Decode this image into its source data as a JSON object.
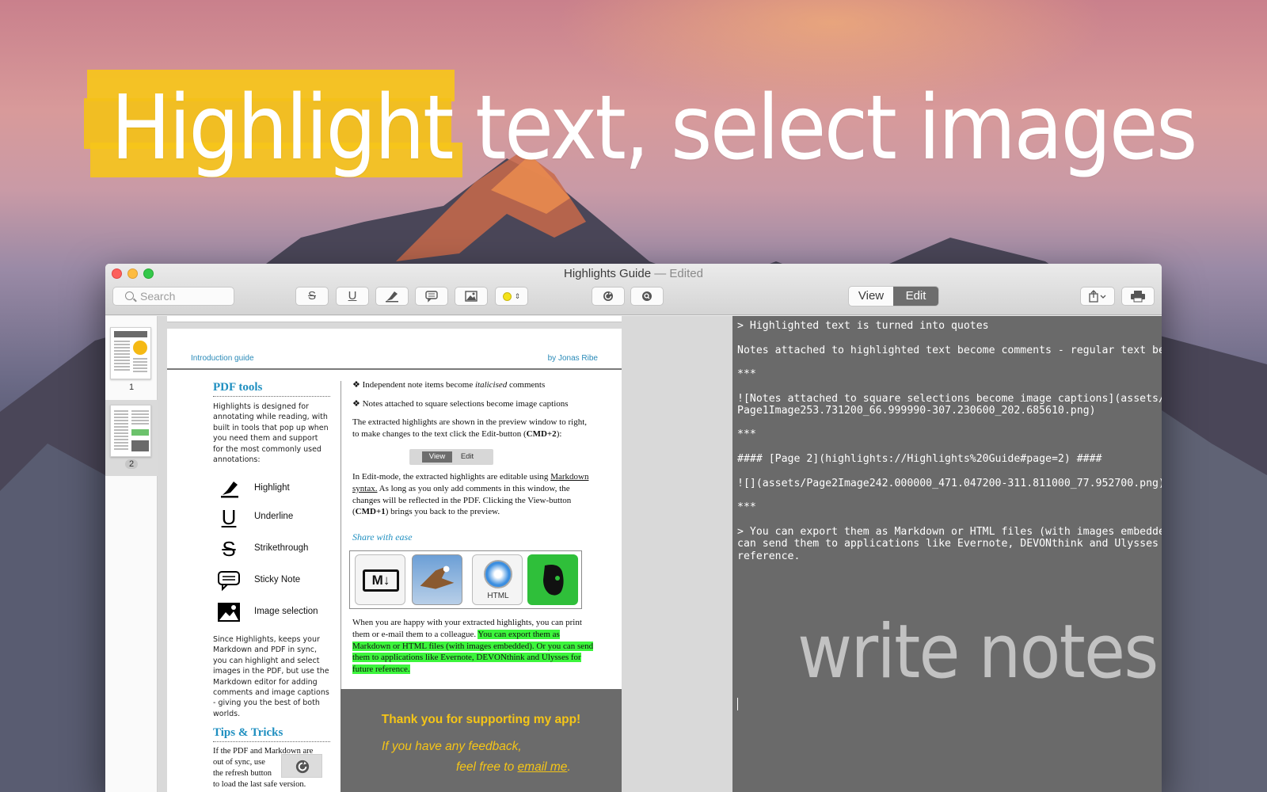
{
  "headline": {
    "highlight_word": "Highlight",
    "rest": " text, select images"
  },
  "window": {
    "title": "Highlights Guide",
    "title_separator": "—",
    "title_status": "Edited"
  },
  "toolbar": {
    "search_placeholder": "Search",
    "strike_glyph": "S",
    "underline_glyph": "U",
    "view_label": "View",
    "edit_label": "Edit"
  },
  "sidebar": {
    "pages": [
      {
        "label": "1"
      },
      {
        "label": "2"
      }
    ]
  },
  "pdf": {
    "header_left": "Introduction guide",
    "header_right": "by Jonas Ribe",
    "pdf_tools_title": "PDF tools",
    "intro_para": "Highlights is designed for annotating while reading, with built in tools that pop up when you need them and support for the  most commonly used annotations:",
    "tools": [
      {
        "label": "Highlight",
        "icon": "highlighter-icon"
      },
      {
        "label": "Underline",
        "icon": "underline-icon"
      },
      {
        "label": "Strikethrough",
        "icon": "strikethrough-icon"
      },
      {
        "label": "Sticky Note",
        "icon": "sticky-note-icon"
      },
      {
        "label": "Image selection",
        "icon": "image-selection-icon"
      }
    ],
    "sync_para": "Since Highlights, keeps your Markdown and PDF in sync, you can highlight and select images in the PDF, but use the Markdown editor for adding comments and image captions - giving you the best of both worlds.",
    "tips_title": "Tips & Tricks",
    "tips_l1": "If the PDF and Markdown are",
    "tips_l2": "out of sync, use",
    "tips_l3": "the refresh button",
    "tips_l4": "to load the last safe version.",
    "bullet1_pre": "❖ Independent note items become ",
    "bullet1_em": "italicised",
    "bullet1_post": " comments",
    "bullet2": "❖ Notes attached to square selections become image captions",
    "preview_pre": "The extracted highlights are shown in the preview window to right, to make changes to the text click the Edit-button (",
    "preview_bold": "CMD+2",
    "preview_post": "):",
    "mini_view": "View",
    "mini_edit": "Edit",
    "editmode_pre": "In Edit-mode, the extracted highlights are editable using ",
    "editmode_link": "Markdown syntax.",
    "editmode_mid": " As long as you only add comments in this window, the changes will be reflected in the PDF. Clicking the View-button (",
    "editmode_bold": "CMD+1",
    "editmode_post": ") brings you back to the preview.",
    "share_title": "Share with ease",
    "html_label": "HTML",
    "export_pre": "When you are happy with your extracted highlights, you can print them or e-mail them to a colleague. ",
    "export_hl": "You can export them as Markdown or HTML files (with images embedded). Or you can send them to applications like Evernote, DEVONthink and Ulysses for future reference.",
    "thanks": "Thank you for supporting my app!",
    "feedback1": "If you have any feedback,",
    "feedback2_pre": "feel free to ",
    "feedback2_link": "email me",
    "feedback2_post": "."
  },
  "editor": {
    "lines": [
      "> Highlighted text is turned into quotes",
      "Notes attached to highlighted text become comments - regular text below the quote",
      "***",
      "![Notes attached to square selections become image captions](assets/",
      "Page1Image253.731200_66.999990-307.230600_202.685610.png)",
      "***",
      "#### [Page 2](highlights://Highlights%20Guide#page=2) ####",
      "![](assets/Page2Image242.000000_471.047200-311.811000_77.952700.png)",
      "***",
      "> You can export them as Markdown or HTML files (with images embedded). Or you",
      "can send them to applications like Evernote, DEVONthink and Ulysses for future",
      "reference."
    ],
    "overlay_text": "write notes"
  },
  "colors": {
    "highlight_yellow": "#f6c51b",
    "link_blue": "#1f8fc0",
    "export_green": "#3cf53c",
    "editor_bg": "#6a6a6a",
    "color_swatch": "#f4e21a"
  }
}
